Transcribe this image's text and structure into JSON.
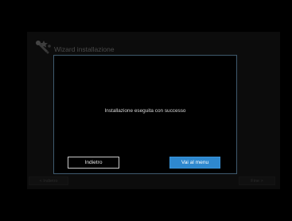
{
  "background_window": {
    "title": "Wizard installazione",
    "icon": "wizard-wand-icon",
    "prev_label": "< Indietro",
    "next_label": "Fine >"
  },
  "dialog": {
    "message": "Installazione eseguita con successo",
    "back_label": "Indietro",
    "menu_label": "Vai al menu"
  },
  "colors": {
    "accent": "#2e88cf",
    "dialog_border": "#3f5a6e",
    "background": "#000000"
  }
}
